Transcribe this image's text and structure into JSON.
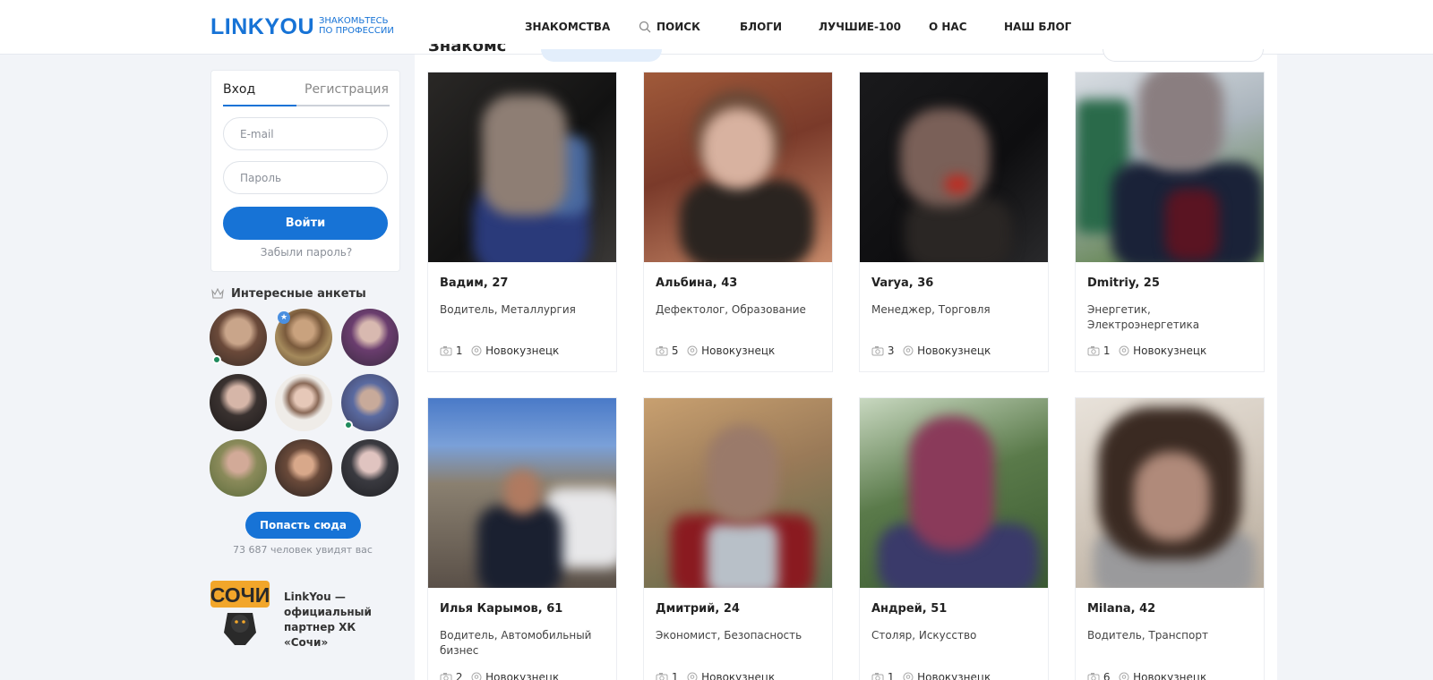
{
  "header": {
    "logo": "LINKYOU",
    "tagline_line1": "ЗНАКОМЬТЕСЬ",
    "tagline_line2": "ПО ПРОФЕССИИ",
    "nav": [
      "ЗНАКОМСТВА",
      "ПОИСК",
      "БЛОГИ",
      "ЛУЧШИЕ-100",
      "О НАС",
      "НАШ БЛОГ"
    ]
  },
  "login": {
    "tab_login": "Вход",
    "tab_register": "Регистрация",
    "email_placeholder": "E-mail",
    "password_placeholder": "Пароль",
    "submit": "Войти",
    "forgot": "Забыли пароль?"
  },
  "interesting": {
    "title": "Интересные анкеты",
    "button": "Попасть сюда",
    "count_text": "73 687 человек увидят вас"
  },
  "partner": {
    "logo_text": "СОЧИ",
    "text": "LinkYou — официальный партнер ХК «Сочи»"
  },
  "profiles": [
    {
      "name": "Вадим, 27",
      "profession": "Водитель, Металлургия",
      "photos": "1",
      "city": "Новокузнецк"
    },
    {
      "name": "Альбина, 43",
      "profession": "Дефектолог, Образование",
      "photos": "5",
      "city": "Новокузнецк"
    },
    {
      "name": "Varya, 36",
      "profession": "Менеджер, Торговля",
      "photos": "3",
      "city": "Новокузнецк"
    },
    {
      "name": "Dmitriy, 25",
      "profession": "Энергетик, Электроэнергетика",
      "photos": "1",
      "city": "Новокузнецк"
    },
    {
      "name": "Илья Карымов, 61",
      "profession": "Водитель, Автомобильный бизнес",
      "photos": "2",
      "city": "Новокузнецк"
    },
    {
      "name": "Дмитрий, 24",
      "profession": "Экономист, Безопасность",
      "photos": "1",
      "city": "Новокузнецк"
    },
    {
      "name": "Андрей, 51",
      "profession": "Столяр, Искусство",
      "photos": "1",
      "city": "Новокузнецк"
    },
    {
      "name": "Milana, 42",
      "profession": "Водитель, Транспорт",
      "photos": "6",
      "city": "Новокузнецк"
    }
  ],
  "colors": {
    "accent": "#1773d6",
    "online": "#1f8a5c",
    "background": "#f2f4f8"
  }
}
